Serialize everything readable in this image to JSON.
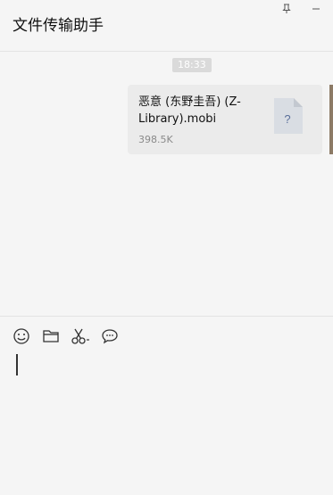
{
  "window": {
    "title": "文件传输助手",
    "pin_icon": "pin-icon",
    "minimize_icon": "minimize-icon"
  },
  "chat": {
    "time": "18:33",
    "messages": [
      {
        "type": "file",
        "file_name": "恶意 (东野圭吾) (Z-Library).mobi",
        "file_size": "398.5K",
        "file_icon": "unknown-file-icon",
        "file_icon_glyph": "?"
      }
    ]
  },
  "composer": {
    "tools": [
      "emoji-icon",
      "folder-icon",
      "scissors-icon",
      "chat-bubble-icon"
    ],
    "input_value": ""
  },
  "colors": {
    "background": "#f5f5f5",
    "bubble": "#ebebeb",
    "time_badge": "#dadada",
    "file_icon": "#d9dde3",
    "file_icon_glyph": "#5a6f9a"
  }
}
